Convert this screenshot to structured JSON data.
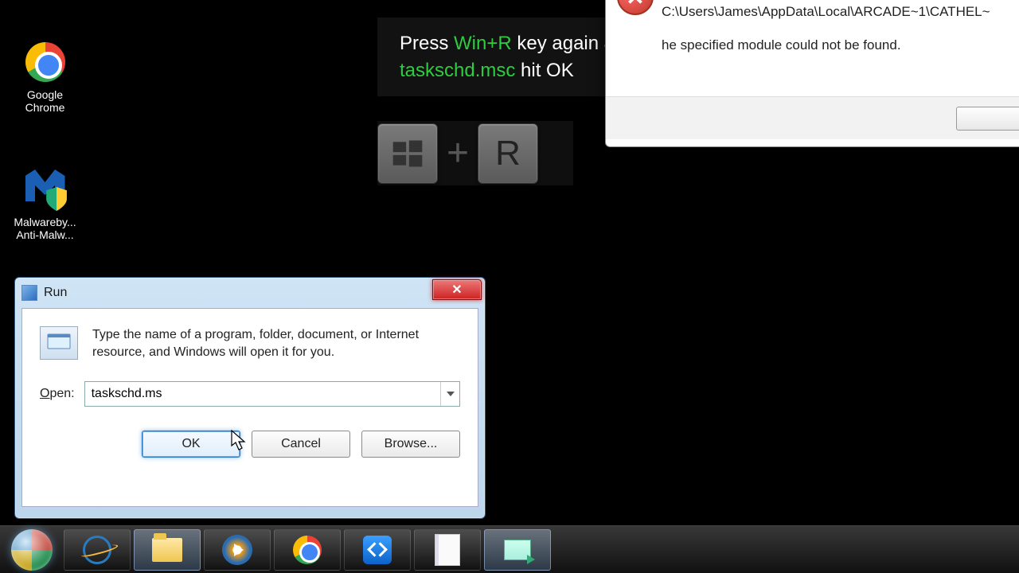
{
  "desktop": {
    "icons": [
      {
        "label": "Google Chrome"
      },
      {
        "label": "Malwareby... Anti-Malw..."
      }
    ]
  },
  "instruction": {
    "pre1": "Press ",
    "key1": "Win+R",
    "post1": " key again & Type ",
    "cmd": "taskschd.msc",
    "post2": " hit OK"
  },
  "keycombo": {
    "win": "Win",
    "plus": "+",
    "r": "R"
  },
  "error_dialog": {
    "path": "C:\\Users\\James\\AppData\\Local\\ARCADE~1\\CATHEL~",
    "message": "he specified module could not be found."
  },
  "run_dialog": {
    "title": "Run",
    "description": "Type the name of a program, folder, document, or Internet resource, and Windows will open it for you.",
    "open_label": "Open:",
    "open_value": "taskschd.ms",
    "ok": "OK",
    "cancel": "Cancel",
    "browse": "Browse..."
  },
  "taskbar": {
    "start": "Start",
    "items": [
      "Internet Explorer",
      "File Explorer",
      "Windows Media Player",
      "Google Chrome",
      "TeamViewer",
      "Notepad",
      "Run"
    ]
  }
}
